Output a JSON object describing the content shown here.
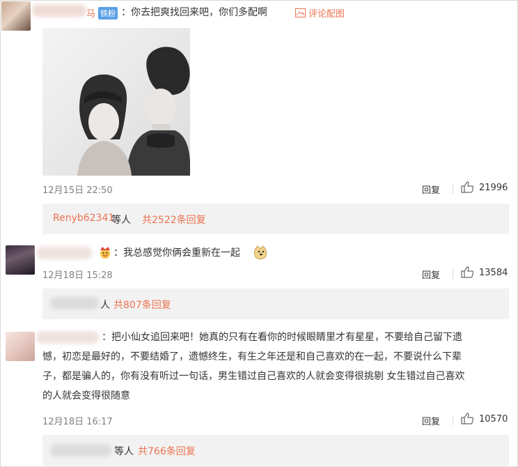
{
  "comments": [
    {
      "user_suffix": "马",
      "badge": "铁粉",
      "text": "：你去把爽找回来吧，你们多配啊",
      "image_action": "评论配图",
      "timestamp": "12月15日 22:50",
      "reply_label": "回复",
      "likes": "21996",
      "thread": {
        "name": "Renyb62341",
        "middle": " 等人 ",
        "count": "共2522条回复"
      }
    },
    {
      "text": "：我总感觉你俩会重新在一起",
      "timestamp": "12月18日 15:28",
      "reply_label": "回复",
      "likes": "13584",
      "thread": {
        "middle": "人 ",
        "count": "共807条回复"
      }
    },
    {
      "text_lines": [
        "：把小仙女追回来吧！她真的只有在看你的时候眼睛里才有星星，不要给自己留下遗",
        "憾，初恋是最好的，不要结婚了，遗憾终生，有生之年还是和自己喜欢的在一起，不要说什么下辈",
        "子，都是骗人的，你有没有听过一句话，男生错过自己喜欢的人就会变得很挑剔 女生错过自己喜欢",
        "的人就会变得很随意"
      ],
      "timestamp": "12月18日 16:17",
      "reply_label": "回复",
      "likes": "10570",
      "thread": {
        "middle": "等人 ",
        "count": "共766条回复"
      }
    }
  ],
  "colors": {
    "accent": "#eb7350",
    "badge": "#5aa0e6",
    "muted": "#808080",
    "thread_bg": "#f2f2f2"
  }
}
